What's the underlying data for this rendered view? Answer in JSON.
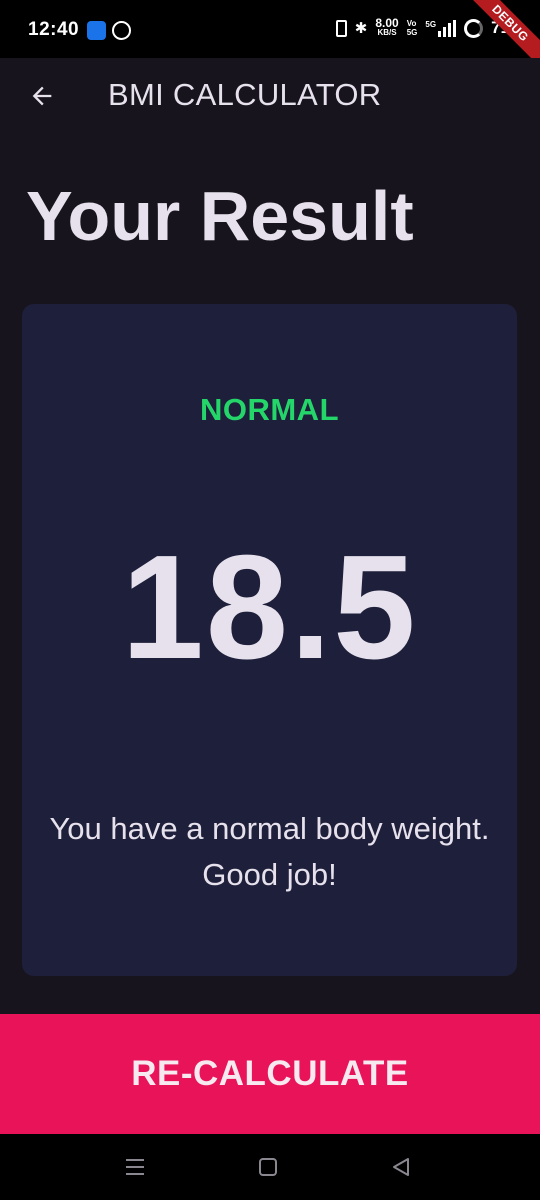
{
  "status_bar": {
    "time": "12:40",
    "speed_value": "8.00",
    "speed_unit": "KB/S",
    "volte_top": "Vo",
    "volte_bottom": "5G",
    "network_badge": "5G",
    "battery_percent": "71"
  },
  "debug_banner": "DEBUG",
  "app_bar": {
    "title": "BMI CALCULATOR",
    "back_icon": "arrow-left-icon"
  },
  "page": {
    "title": "Your Result"
  },
  "result": {
    "status": "NORMAL",
    "status_color": "#24d66a",
    "bmi": "18.5",
    "message": "You have a normal body weight. Good job!"
  },
  "actions": {
    "recalculate_label": "RE-CALCULATE",
    "recalculate_color": "#e9135a"
  },
  "nav": {
    "menu_icon": "menu-icon",
    "home_icon": "home-square-icon",
    "back_icon": "back-triangle-icon"
  }
}
